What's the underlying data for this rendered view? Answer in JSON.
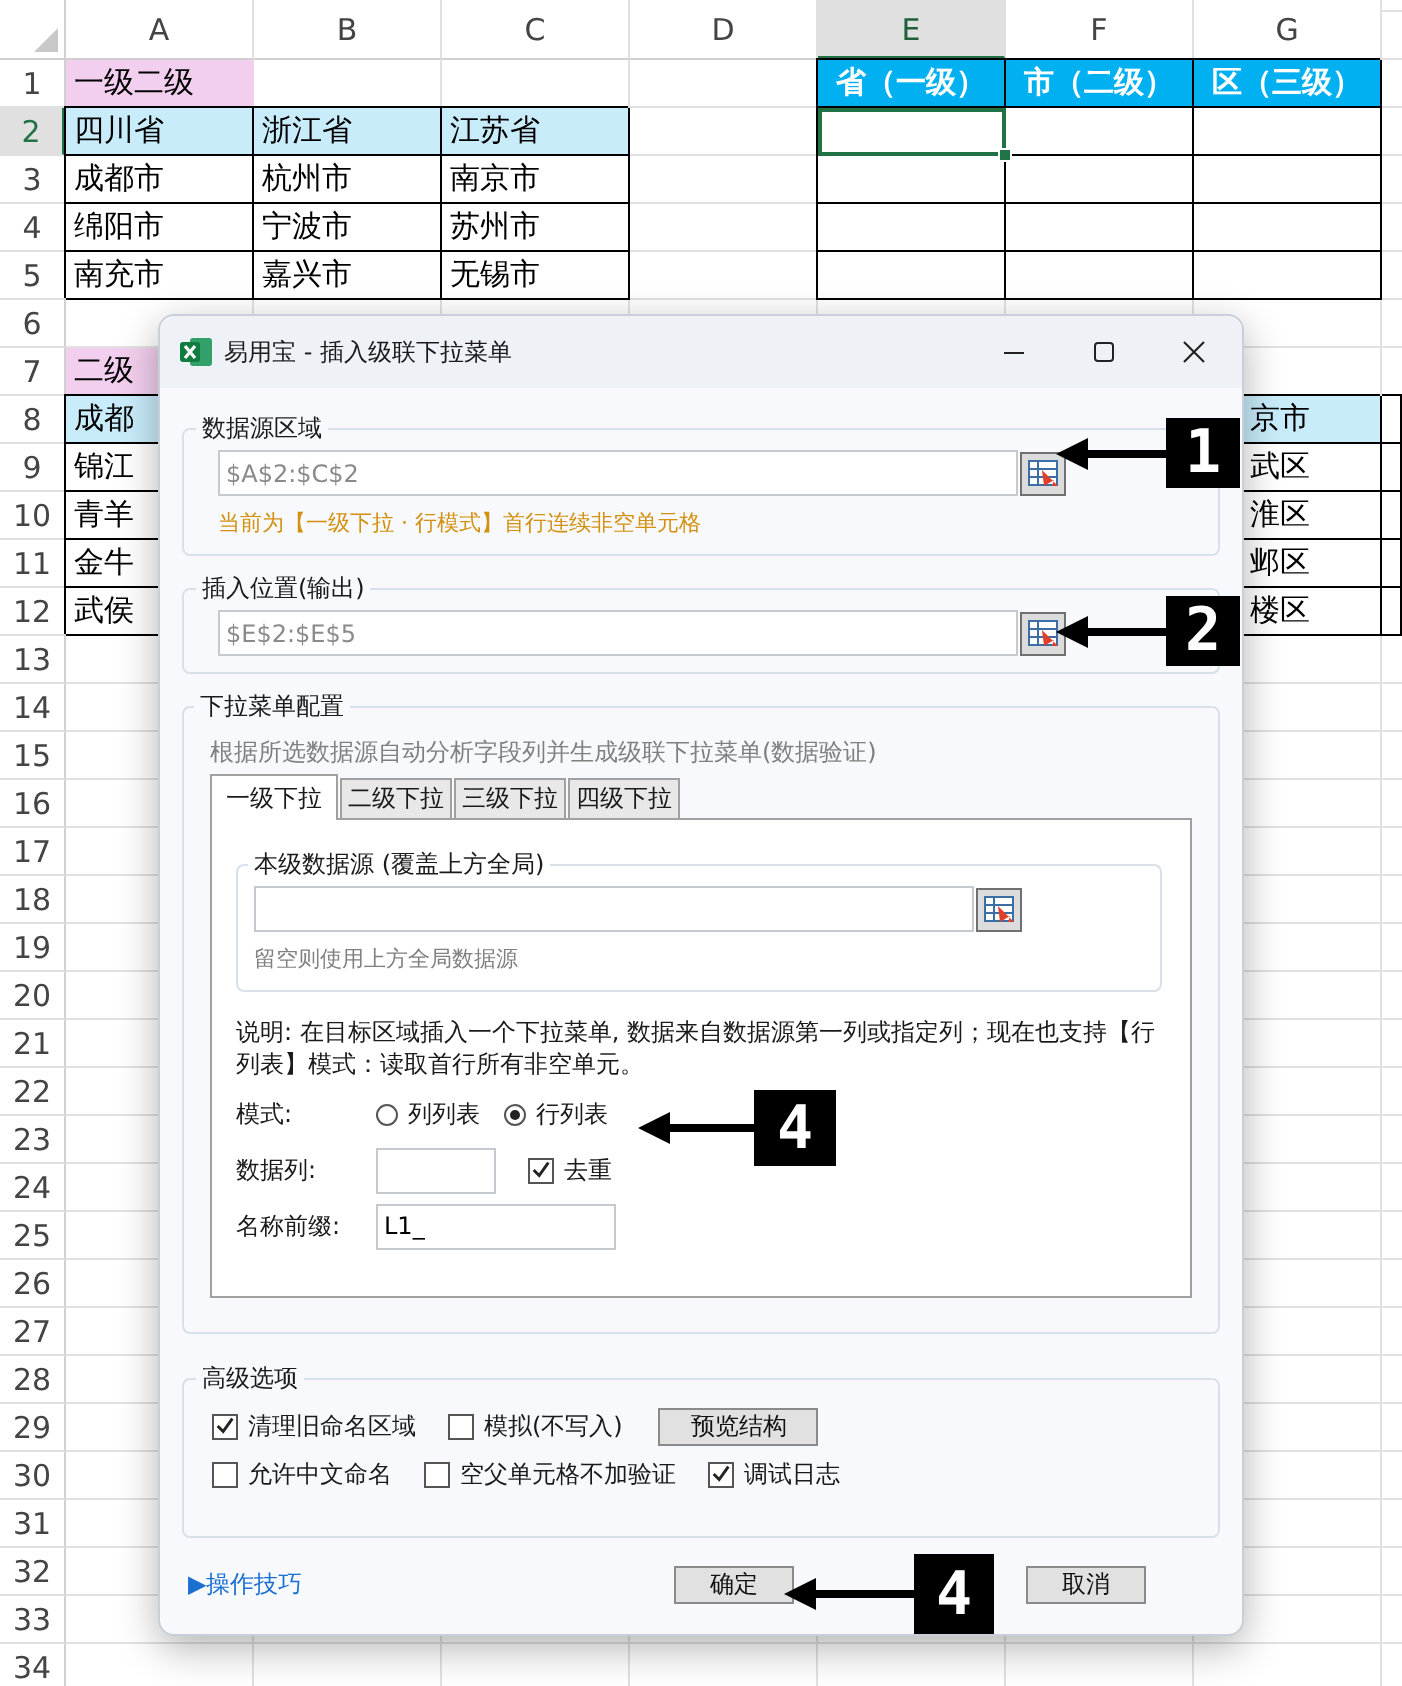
{
  "sheet": {
    "columns": [
      {
        "label": "A",
        "selected": false
      },
      {
        "label": "B",
        "selected": false
      },
      {
        "label": "C",
        "selected": false
      },
      {
        "label": "D",
        "selected": false
      },
      {
        "label": "E",
        "selected": true
      },
      {
        "label": "F",
        "selected": false
      },
      {
        "label": "G",
        "selected": false
      }
    ],
    "rows": [
      {
        "number": "1",
        "selected": false,
        "cells": [
          {
            "kind": "label",
            "text": "一级二级",
            "selected": false
          },
          {
            "kind": "blank"
          },
          {
            "kind": "blank"
          },
          {
            "kind": "blank"
          },
          {
            "kind": "header",
            "text": "省（一级）",
            "selected": false
          },
          {
            "kind": "header",
            "text": "市（二级）",
            "selected": false
          },
          {
            "kind": "header",
            "text": "区（三级）",
            "selected": false
          }
        ]
      },
      {
        "number": "2",
        "selected": true,
        "cells": [
          {
            "kind": "key",
            "text": "四川省",
            "selected": false
          },
          {
            "kind": "key",
            "text": "浙江省",
            "selected": false
          },
          {
            "kind": "key",
            "text": "江苏省",
            "selected": false
          },
          {
            "kind": "blank"
          },
          {
            "kind": "data",
            "selected": true
          },
          {
            "kind": "data"
          },
          {
            "kind": "data"
          }
        ]
      },
      {
        "number": "3",
        "selected": false,
        "cells": [
          {
            "kind": "data",
            "text": "成都市",
            "selected": false
          },
          {
            "kind": "data",
            "text": "杭州市",
            "selected": false
          },
          {
            "kind": "data",
            "text": "南京市",
            "selected": false
          },
          {
            "kind": "blank"
          },
          {
            "kind": "data"
          },
          {
            "kind": "data"
          },
          {
            "kind": "data"
          }
        ]
      },
      {
        "number": "4",
        "selected": false,
        "cells": [
          {
            "kind": "data",
            "text": "绵阳市",
            "selected": false
          },
          {
            "kind": "data",
            "text": "宁波市",
            "selected": false
          },
          {
            "kind": "data",
            "text": "苏州市",
            "selected": false
          },
          {
            "kind": "blank"
          },
          {
            "kind": "data"
          },
          {
            "kind": "data"
          },
          {
            "kind": "data"
          }
        ]
      },
      {
        "number": "5",
        "selected": false,
        "cells": [
          {
            "kind": "data",
            "text": "南充市",
            "selected": false
          },
          {
            "kind": "data",
            "text": "嘉兴市",
            "selected": false
          },
          {
            "kind": "data",
            "text": "无锡市",
            "selected": false
          },
          {
            "kind": "blank"
          },
          {
            "kind": "data"
          },
          {
            "kind": "data"
          },
          {
            "kind": "data"
          }
        ]
      },
      {
        "number": "6",
        "selected": false
      },
      {
        "number": "7",
        "selected": false,
        "left": {
          "kind": "label",
          "text": "二级",
          "selected": false
        }
      },
      {
        "number": "8",
        "selected": false,
        "left": {
          "kind": "key",
          "text": "成都",
          "selected": false
        },
        "right": {
          "kind": "key",
          "text": "京市",
          "selected": false
        }
      },
      {
        "number": "9",
        "selected": false,
        "left": {
          "kind": "data",
          "text": "锦江",
          "selected": false
        },
        "right": {
          "kind": "data",
          "text": "武区",
          "selected": false
        }
      },
      {
        "number": "10",
        "selected": false,
        "left": {
          "kind": "data",
          "text": "青羊",
          "selected": false
        },
        "right": {
          "kind": "data",
          "text": "淮区",
          "selected": false
        }
      },
      {
        "number": "11",
        "selected": false,
        "left": {
          "kind": "data",
          "text": "金牛",
          "selected": false
        },
        "right": {
          "kind": "data",
          "text": "邺区",
          "selected": false
        }
      },
      {
        "number": "12",
        "selected": false,
        "left": {
          "kind": "data",
          "text": "武侯",
          "selected": false
        },
        "right": {
          "kind": "data",
          "text": "楼区",
          "selected": false
        }
      },
      {
        "number": "13",
        "selected": false
      },
      {
        "number": "14",
        "selected": false
      },
      {
        "number": "15",
        "selected": false
      },
      {
        "number": "16",
        "selected": false
      },
      {
        "number": "17",
        "selected": false
      },
      {
        "number": "18",
        "selected": false
      },
      {
        "number": "19",
        "selected": false
      },
      {
        "number": "20",
        "selected": false
      },
      {
        "number": "21",
        "selected": false
      },
      {
        "number": "22",
        "selected": false
      },
      {
        "number": "23",
        "selected": false
      },
      {
        "number": "24",
        "selected": false
      },
      {
        "number": "25",
        "selected": false
      },
      {
        "number": "26",
        "selected": false
      },
      {
        "number": "27",
        "selected": false
      },
      {
        "number": "28",
        "selected": false
      },
      {
        "number": "29",
        "selected": false
      },
      {
        "number": "30",
        "selected": false
      },
      {
        "number": "31",
        "selected": false
      },
      {
        "number": "32",
        "selected": false
      },
      {
        "number": "33",
        "selected": false
      },
      {
        "number": "34",
        "selected": false
      }
    ]
  },
  "dialog": {
    "title": "易用宝 - 插入级联下拉菜单",
    "source_group": {
      "title": "数据源区域",
      "value": "$A$2:$C$2",
      "hint": "当前为【一级下拉 · 行模式】首行连续非空单元格"
    },
    "output_group": {
      "title": "插入位置(输出)",
      "value": "$E$2:$E$5"
    },
    "config_group": {
      "title": "下拉菜单配置",
      "description": "根据所选数据源自动分析字段列并生成级联下拉菜单(数据验证)",
      "tabs": [
        {
          "label": "一级下拉",
          "selected": true
        },
        {
          "label": "二级下拉",
          "selected": false
        },
        {
          "label": "三级下拉",
          "selected": false
        },
        {
          "label": "四级下拉",
          "selected": false
        }
      ],
      "level_source": {
        "title": "本级数据源 (覆盖上方全局)",
        "hint": "留空则使用上方全局数据源"
      },
      "explanation": "说明: 在目标区域插入一个下拉菜单, 数据来自数据源第一列或指定列；现在也支持【行列表】模式：读取首行所有非空单元。",
      "mode": {
        "label": "模式:",
        "options": [
          {
            "label": "列列表",
            "selected": false
          },
          {
            "label": "行列表",
            "selected": true
          }
        ]
      },
      "data_column": {
        "label": "数据列:"
      },
      "dedupe": {
        "label": "去重",
        "checked": true
      },
      "name_prefix": {
        "label": "名称前缀:",
        "value": "L1_"
      }
    },
    "advanced": {
      "title": "高级选项",
      "rows": [
        [
          {
            "kind": "checkbox",
            "label": "清理旧命名区域",
            "checked": true
          },
          {
            "kind": "checkbox",
            "label": "模拟(不写入)",
            "checked": false
          },
          {
            "kind": "button",
            "label": "预览结构"
          }
        ],
        [
          {
            "kind": "checkbox",
            "label": "允许中文命名",
            "checked": false
          },
          {
            "kind": "checkbox",
            "label": "空父单元格不加验证",
            "checked": false
          },
          {
            "kind": "checkbox",
            "label": "调试日志",
            "checked": true
          }
        ]
      ]
    },
    "tips_link": "▶操作技巧",
    "buttons": [
      "确定",
      "取消"
    ]
  },
  "callouts": [
    {
      "text": "1"
    },
    {
      "text": "2"
    },
    {
      "text": "4"
    },
    {
      "text": "4"
    }
  ]
}
